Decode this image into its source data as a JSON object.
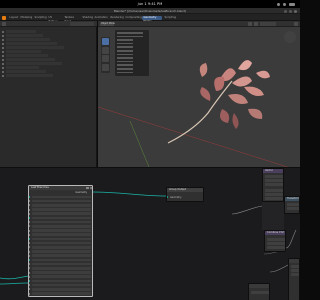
{
  "os_bar": {
    "clock": "Jun 1 9:41 PM"
  },
  "window": {
    "title": "Blender* [/home/user/Downloads/leafbranch.blend]"
  },
  "workspaces": [
    "Layout",
    "Modeling",
    "Sculpting",
    "UV Editing",
    "Texture Paint",
    "Shading",
    "Animation",
    "Rendering",
    "Compositing",
    "Geometry Nodes",
    "Scripting"
  ],
  "active_workspace_index": 9,
  "viewport": {
    "mode": "Object Mode"
  },
  "nodes": {
    "main": {
      "title": "Leaf Branches",
      "output_label": "Geometry"
    },
    "group_output": {
      "title": "Group Output",
      "input_label": "Geometry"
    },
    "node_a": {
      "title": "Vector"
    },
    "node_b": {
      "title": "Transform"
    },
    "node_c": {
      "title": "Combine XYZ"
    }
  },
  "colors": {
    "accent": "#4b6fa5",
    "leaf": "#c8847e",
    "stem": "#d9c7b5",
    "x_axis": "#9c3a3a",
    "y_axis": "#5c8a3a",
    "link_geometry": "#1bb6a8"
  }
}
